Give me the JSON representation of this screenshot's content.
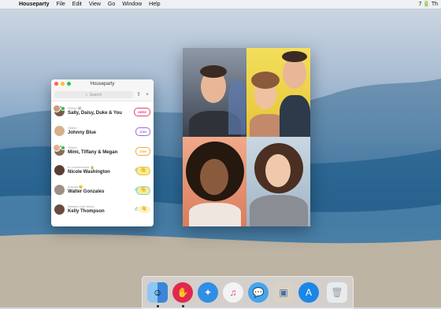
{
  "menubar": {
    "app_name": "Houseparty",
    "menus": [
      "File",
      "Edit",
      "View",
      "Go",
      "Window",
      "Help"
    ],
    "right_text": "7 🔋 Th"
  },
  "window": {
    "title": "Houseparty",
    "search_placeholder": "Search",
    "contacts": [
      {
        "status": "Online 🗓",
        "name": "Sally, Daisy, Duke & You",
        "action": "HERE",
        "action_color": "#e0457b"
      },
      {
        "status": "Online",
        "name": "Johnny Blue",
        "action": "JOIN",
        "action_color": "#9b6ad6"
      },
      {
        "status": "Online",
        "name": "Mimi, Tiffany & Megan",
        "action": "JOIN",
        "action_color": "#f2a93b"
      },
      {
        "status": "In a screenshot 🔒",
        "name": "Nicole Washington",
        "action": "👋",
        "action_color": "#e6c93a"
      },
      {
        "status": "Around 🙂",
        "name": "Walter Gonzales",
        "action": "👋",
        "action_color": "#7ad6d1"
      },
      {
        "status": "Wanted Last Week",
        "name": "Kelly Thompson",
        "action": "👋",
        "action_color": "#f4e6a0"
      }
    ]
  },
  "dock": {
    "apps": [
      "finder-icon",
      "houseparty-icon",
      "safari-icon",
      "itunes-icon",
      "messages-icon",
      "preview-icon",
      "app-store-icon",
      "trash-icon"
    ]
  }
}
